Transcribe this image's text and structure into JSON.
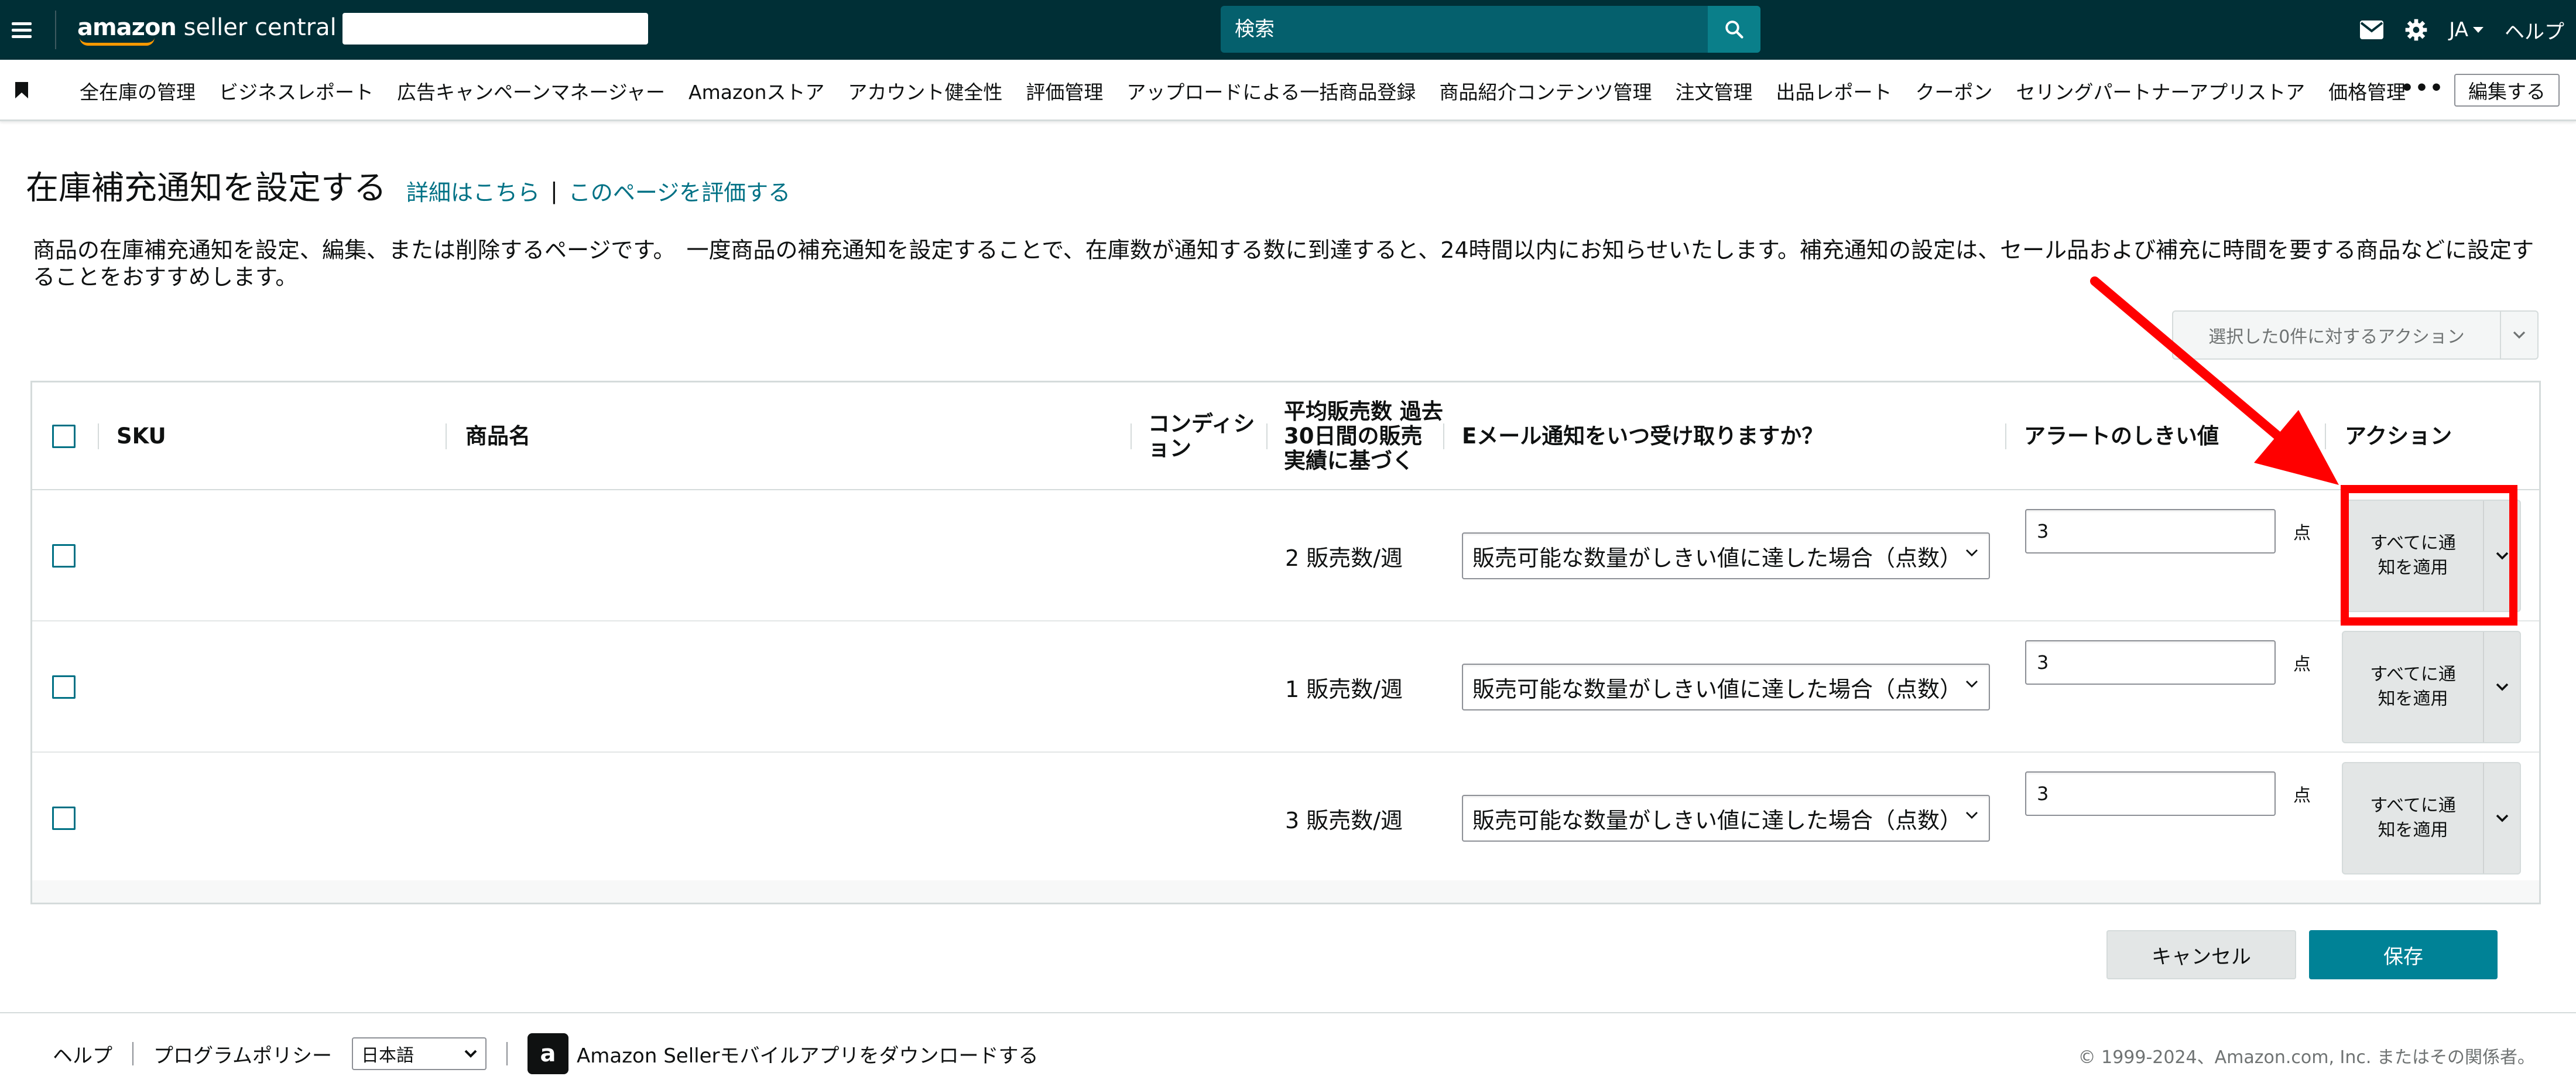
{
  "header": {
    "logo_bold": "amazon",
    "logo_rest": " seller central",
    "search_placeholder": "検索",
    "language": "JA",
    "help": "ヘルプ"
  },
  "nav": {
    "items": [
      "全在庫の管理",
      "ビジネスレポート",
      "広告キャンペーンマネージャー",
      "Amazonストア",
      "アカウント健全性",
      "評価管理",
      "アップロードによる一括商品登録",
      "商品紹介コンテンツ管理",
      "注文管理",
      "出品レポート",
      "クーポン",
      "セリングパートナーアプリストア",
      "価格管理"
    ],
    "more": "•••",
    "edit": "編集する"
  },
  "page": {
    "title": "在庫補充通知を設定する",
    "link_details": "詳細はこちら",
    "separator": "|",
    "link_rate": "このページを評価する",
    "description": "商品の在庫補充通知を設定、編集、または削除するページです。　一度商品の補充通知を設定することで、在庫数が通知する数に到達すると、24時間以内にお知らせいたします。補充通知の設定は、セール品および補充に時間を要する商品などに設定することをおすすめします。",
    "bulk_action": "選択した0件に対するアクション"
  },
  "table": {
    "headers": {
      "sku": "SKU",
      "product": "商品名",
      "condition": "コンディション",
      "avg_sales": "平均販売数 過去30日間の販売実績に基づく",
      "email": "Eメール通知をいつ受け取りますか？",
      "threshold": "アラートのしきい値",
      "action": "アクション"
    },
    "rows": [
      {
        "sales": "2 販売数/週",
        "notify": "販売可能な数量がしきい値に達した場合（点数）",
        "threshold": "3",
        "unit": "点",
        "action": "すべてに通知を適用"
      },
      {
        "sales": "1 販売数/週",
        "notify": "販売可能な数量がしきい値に達した場合（点数）",
        "threshold": "3",
        "unit": "点",
        "action": "すべてに通知を適用"
      },
      {
        "sales": "3 販売数/週",
        "notify": "販売可能な数量がしきい値に達した場合（点数）",
        "threshold": "3",
        "unit": "点",
        "action": "すべてに通知を適用"
      }
    ]
  },
  "buttons": {
    "cancel": "キャンセル",
    "save": "保存"
  },
  "footer": {
    "help": "ヘルプ",
    "policy": "プログラムポリシー",
    "language": "日本語",
    "app": "Amazon Sellerモバイルアプリをダウンロードする",
    "copyright": "© 1999-2024、Amazon.com, Inc. またはその関係者。"
  },
  "colors": {
    "topbar": "#002f36",
    "accent": "#008296",
    "link": "#007185",
    "annotation": "#ff0000"
  }
}
